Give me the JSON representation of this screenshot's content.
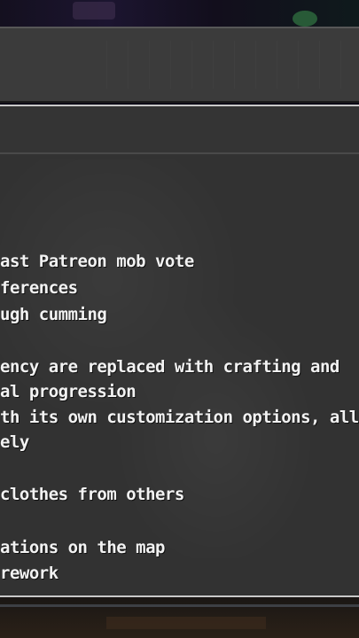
{
  "changelog": {
    "lines": [
      "ast Patreon mob vote",
      "ferences",
      "ugh cumming",
      "ency are replaced with crafting and",
      "al progression",
      "th its own customization options, all",
      "ely",
      "clothes from others",
      "ations on the map",
      " rework"
    ]
  },
  "colors": {
    "panel": "#323232",
    "header": "#3b3b3b",
    "border": "#c9c9c9",
    "text": "#f2f2f2"
  }
}
